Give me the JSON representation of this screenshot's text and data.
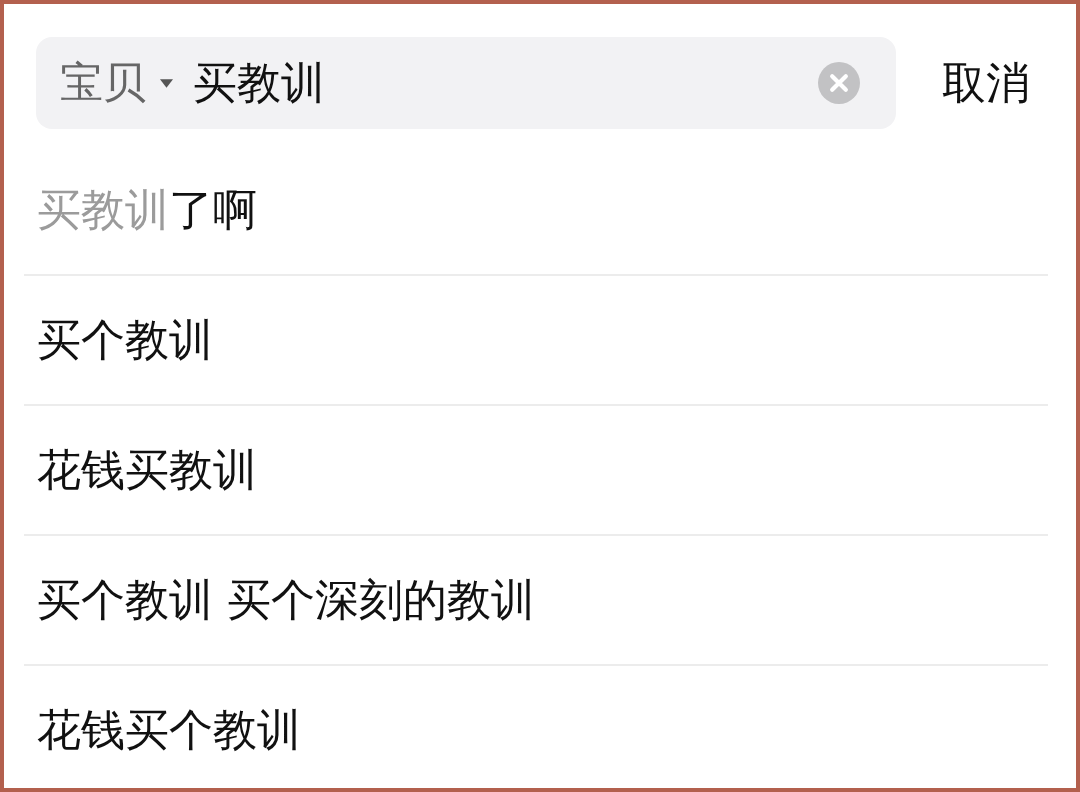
{
  "search_bar": {
    "scope": "宝贝",
    "query": "买教训"
  },
  "cancel_button": "取消",
  "suggestions": [
    {
      "matched": "买教训",
      "text": "了啊"
    },
    {
      "text": "买个教训"
    },
    {
      "text": "花钱买教训"
    },
    {
      "text": "买个教训 买个深刻的教训"
    },
    {
      "text": "花钱买个教训"
    }
  ]
}
